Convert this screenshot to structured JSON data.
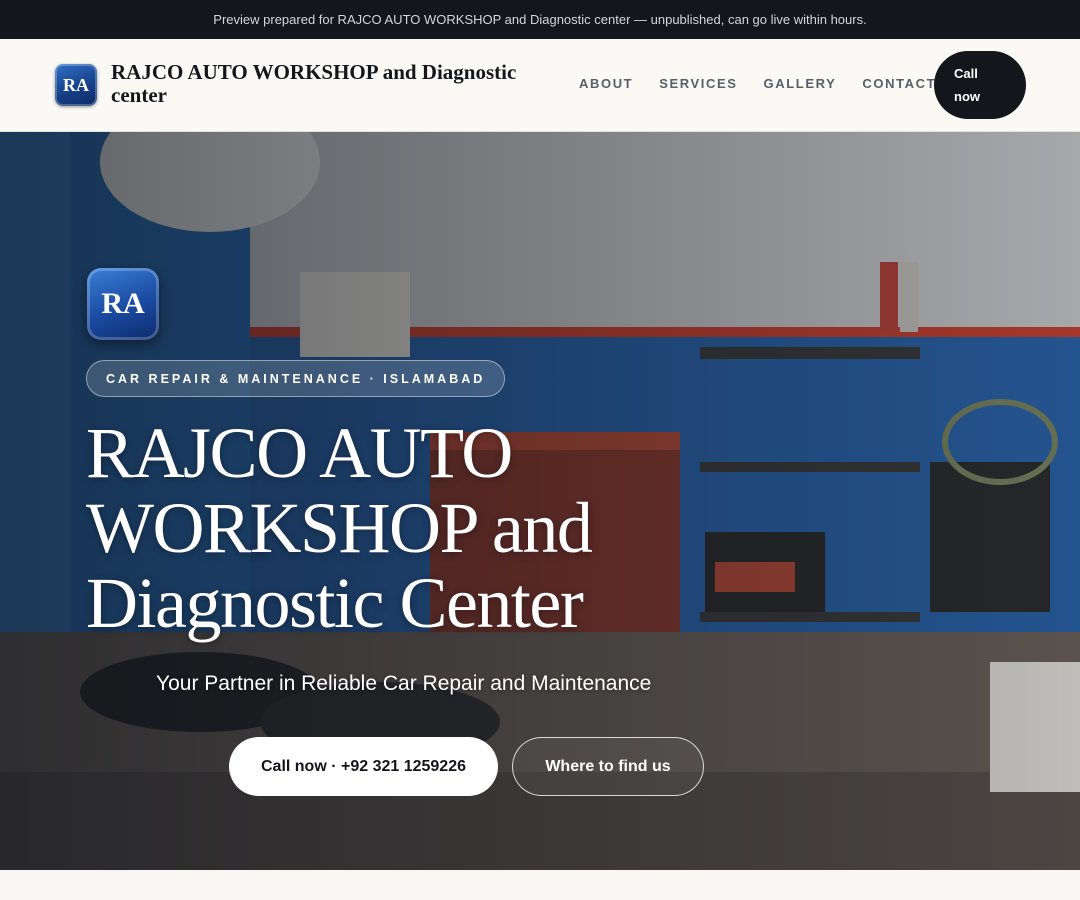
{
  "banner": {
    "text": "Preview prepared for RAJCO AUTO WORKSHOP and Diagnostic center — unpublished, can go live within hours."
  },
  "header": {
    "logo_text": "RA",
    "brand_name": "RAJCO AUTO WORKSHOP and Diagnostic center",
    "nav": [
      {
        "label": "ABOUT"
      },
      {
        "label": "SERVICES"
      },
      {
        "label": "GALLERY"
      },
      {
        "label": "CONTACT"
      }
    ],
    "call_line1": "Call",
    "call_line2": "now"
  },
  "hero": {
    "logo_text": "RA",
    "tagline": "CAR REPAIR & MAINTENANCE · ISLAMABAD",
    "title": "RAJCO AUTO WORKSHOP and Diagnostic Center",
    "subtitle": "Your Partner in Reliable Car Repair and Maintenance",
    "primary_button": "Call now · +92 321 1259226",
    "secondary_button": "Where to find us",
    "photo_icon": "workshop-photo"
  },
  "colors": {
    "banner_bg": "#14161b",
    "header_bg": "#faf9f6",
    "accent_dark": "#14161b",
    "logo_blue": "#1a4aa0",
    "wall_blue": "#2a63a8",
    "wall_red": "#c8402e"
  }
}
